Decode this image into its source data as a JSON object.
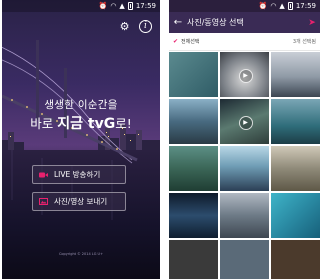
{
  "status_bar": {
    "time": "17:59",
    "icons": [
      "alarm-icon",
      "wifi-icon",
      "signal-icon",
      "battery-icon"
    ]
  },
  "launch_screen": {
    "headline_line1": "생생한 이순간을",
    "headline_line2_prefix": "바로 ",
    "headline_line2_brand": "지금 tvG",
    "headline_line2_suffix": "로!",
    "live_button_label": "LIVE 방송하기",
    "send_button_label": "사진/영상 보내기",
    "copyright": "Copyright © 2014 LG U+",
    "icons": [
      "settings-icon",
      "info-icon",
      "video-camera-icon",
      "photo-icon"
    ],
    "colors": {
      "accent": "#e8216e"
    }
  },
  "picker_screen": {
    "title": "사진/동영상 선택",
    "select_all_label": "전체선택",
    "selected_count": "3개 선택됨",
    "icons": [
      "back-arrow-icon",
      "send-icon",
      "check-icon",
      "play-icon"
    ],
    "colors": {
      "appbar": "#3a2b55",
      "accent": "#e8216e"
    },
    "thumbnails": [
      {
        "video": false
      },
      {
        "video": true
      },
      {
        "video": false
      },
      {
        "video": false
      },
      {
        "video": true
      },
      {
        "video": false
      },
      {
        "video": false
      },
      {
        "video": false
      },
      {
        "video": false
      },
      {
        "video": false
      },
      {
        "video": false
      },
      {
        "video": false
      },
      {
        "video": false
      },
      {
        "video": false
      },
      {
        "video": false
      }
    ]
  }
}
